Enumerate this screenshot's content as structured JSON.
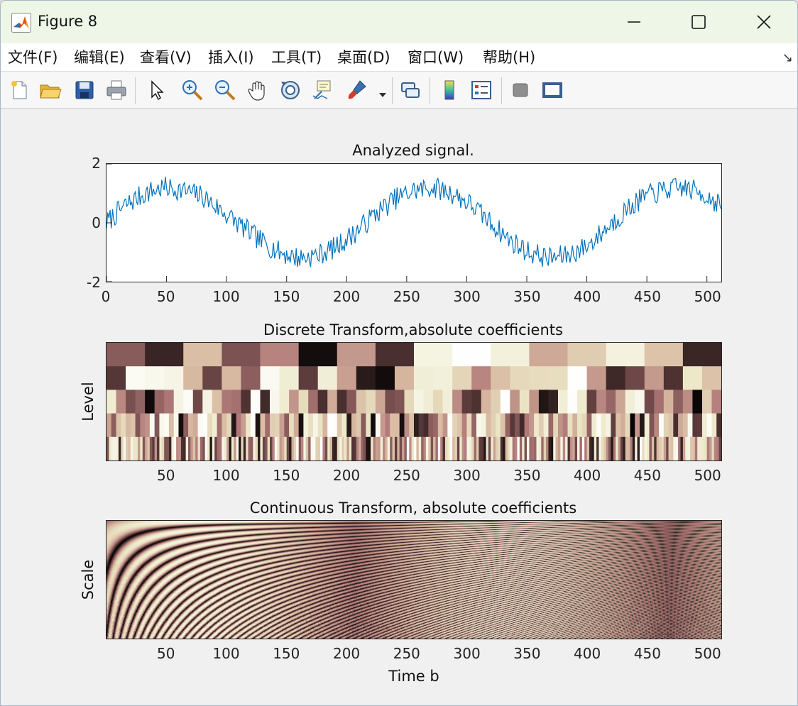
{
  "window": {
    "title": "Figure 8"
  },
  "menu": {
    "items": [
      "文件(F)",
      "编辑(E)",
      "查看(V)",
      "插入(I)",
      "工具(T)",
      "桌面(D)",
      "窗口(W)",
      "帮助(H)"
    ]
  },
  "toolbar": {
    "buttons": [
      "new-figure-icon",
      "open-file-icon",
      "save-icon",
      "print-icon",
      "pointer-icon",
      "zoom-in-icon",
      "zoom-out-icon",
      "pan-hand-icon",
      "rotate-3d-icon",
      "data-cursor-icon",
      "brush-icon",
      "link-plot-icon",
      "colorbar-icon",
      "legend-icon",
      "hide-plot-tools-icon",
      "show-plot-tools-icon"
    ]
  },
  "colors": {
    "signal_line": "#0072bd",
    "colormap": [
      "#000000",
      "#5a3a3a",
      "#b07878",
      "#d7b8a0",
      "#ece8c8",
      "#ffffff"
    ]
  },
  "chart_data": [
    {
      "type": "line",
      "title": "Analyzed signal.",
      "xlabel": "",
      "ylabel": "",
      "xlim": [
        0,
        512
      ],
      "ylim": [
        -2,
        2
      ],
      "xticks": [
        "0",
        "50",
        "100",
        "150",
        "200",
        "250",
        "300",
        "350",
        "400",
        "450",
        "500"
      ],
      "yticks": [
        "2",
        "0",
        "-2"
      ],
      "series": [
        {
          "x": [
            0,
            16,
            32,
            48,
            64,
            80,
            96,
            112,
            128,
            144,
            160,
            176,
            192,
            208,
            224,
            240,
            256,
            272,
            288,
            304,
            320,
            336,
            352,
            368,
            384,
            400,
            416,
            432,
            448,
            464,
            480,
            496,
            512
          ],
          "values": [
            0.0,
            0.6,
            1.0,
            1.2,
            1.1,
            0.9,
            0.4,
            -0.1,
            -0.6,
            -1.0,
            -1.2,
            -1.1,
            -0.8,
            -0.3,
            0.3,
            0.8,
            1.1,
            1.2,
            1.0,
            0.6,
            0.0,
            -0.6,
            -1.0,
            -1.2,
            -1.1,
            -0.8,
            -0.2,
            0.4,
            0.9,
            1.1,
            1.2,
            1.0,
            0.6
          ]
        }
      ]
    },
    {
      "type": "heatmap",
      "title": "Discrete Transform,absolute coefficients",
      "xlabel": "",
      "ylabel": "Level",
      "xlim": [
        0,
        512
      ],
      "xticks": [
        "50",
        "100",
        "150",
        "200",
        "250",
        "300",
        "350",
        "400",
        "450",
        "500"
      ],
      "levels": 5
    },
    {
      "type": "heatmap",
      "title": "Continuous Transform, absolute coefficients",
      "xlabel": "Time b",
      "ylabel": "Scale",
      "xlim": [
        0,
        512
      ],
      "xticks": [
        "50",
        "100",
        "150",
        "200",
        "250",
        "300",
        "350",
        "400",
        "450",
        "500"
      ]
    }
  ]
}
